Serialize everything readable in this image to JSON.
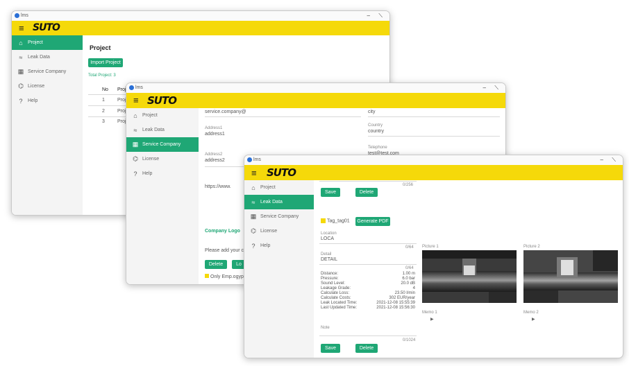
{
  "app_title": "lms",
  "logo": "SUTO",
  "nav": [
    "Project",
    "Leak Data",
    "Service Company",
    "License",
    "Help"
  ],
  "win1": {
    "page_title": "Project",
    "import_button": "Import Project",
    "total_projects": "Total Project: 3",
    "col_no": "No",
    "col_project": "Proj",
    "rows": [
      {
        "no": "1",
        "name": "Proje"
      },
      {
        "no": "2",
        "name": "Proje"
      },
      {
        "no": "3",
        "name": "Proje"
      }
    ]
  },
  "win2": {
    "email_value": "service.company@",
    "city_label": "city",
    "address1_label": "Address1",
    "address1_value": "address1",
    "country_label": "Country",
    "country_value": "country",
    "address2_label": "Address2",
    "address2_value": "address2",
    "telephone_label": "Telephone",
    "telephone_value": "test@test.com",
    "website_value": "https://www.",
    "company_logo_label": "Company Logo",
    "please_text": "Please add your com",
    "delete_button": "Delete",
    "other_button": "Lo",
    "checkbox_text": "Only Emp.ogypa"
  },
  "win3": {
    "save_button": "Save",
    "delete_button": "Delete",
    "tag_text": "Tag_tag01",
    "generate_button": "Generate PDF",
    "location_label": "Location",
    "location_value": "LOCA",
    "detail_label": "Detail",
    "detail_value": "DETAIL",
    "metrics": [
      {
        "label": "Distance:",
        "value": "1.00 m"
      },
      {
        "label": "Pressure:",
        "value": "6.0 bar"
      },
      {
        "label": "Sound Level:",
        "value": "20.0 dB"
      },
      {
        "label": "Leakage Grade:",
        "value": "4"
      },
      {
        "label": "Calculate Loss:",
        "value": "23.50 l/min"
      },
      {
        "label": "Calculate Costs:",
        "value": "302 EUR/year"
      },
      {
        "label": "Leak Located Time:",
        "value": "2021-12-08 15:55:39"
      },
      {
        "label": "Last Updated Time:",
        "value": "2021-12-08 15:56:30"
      }
    ],
    "note_label": "Note",
    "picture1_label": "Picture 1",
    "picture2_label": "Picture 2",
    "memo1_label": "Memo 1",
    "memo2_label": "Memo 2",
    "bottom_save_button": "Save",
    "bottom_delete_button": "Delete",
    "counter_64a": "0/64",
    "counter_64b": "0/64",
    "counter_1024": "0/1024",
    "counter_top": "0/256"
  },
  "colors": {
    "accent_green": "#1fa775",
    "brand_yellow": "#f5d90a"
  }
}
